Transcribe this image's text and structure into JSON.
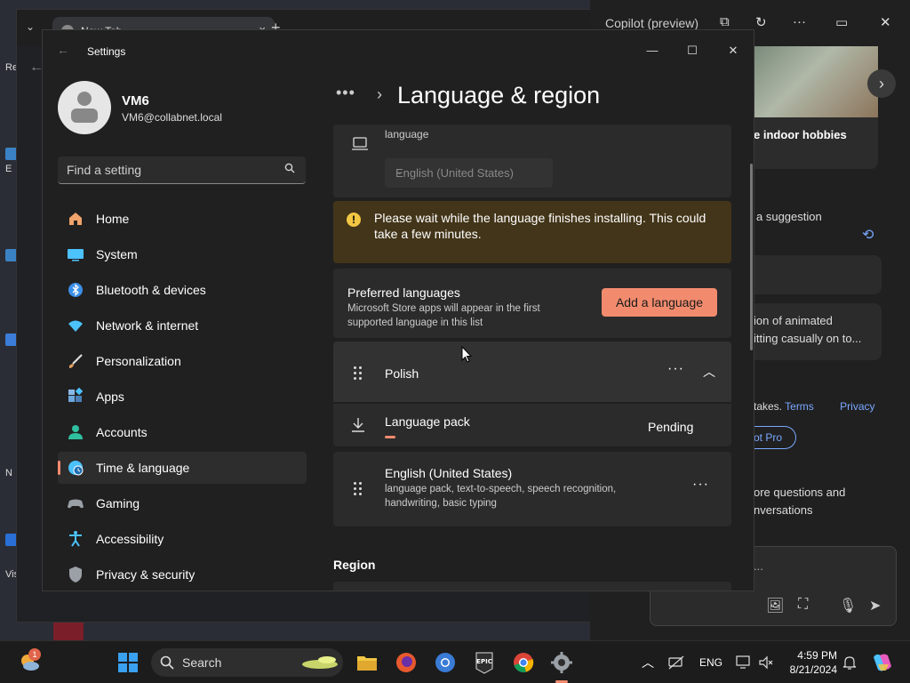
{
  "browser": {
    "tab_title": "New Tab",
    "new_tab_symbol": "+",
    "tab_close": "×"
  },
  "copilot": {
    "title": "Copilot (preview)",
    "card_text": "e indoor hobbies",
    "suggestion_header": "a suggestion",
    "suggestion_line1": "ion of animated",
    "suggestion_line2": "itting casually on to...",
    "terms_prefix": "takes.",
    "terms_link": "Terms",
    "privacy_link": "Privacy",
    "pro_label": "ot Pro",
    "more_line1": "ore questions and",
    "more_line2": "nversations",
    "input_placeholder": "..."
  },
  "desktop": {
    "labels": [
      "Re",
      "E",
      "N",
      "Vis"
    ]
  },
  "settings": {
    "window_title": "Settings",
    "user": {
      "name": "VM6",
      "email": "VM6@collabnet.local"
    },
    "search": {
      "placeholder": "Find a setting"
    },
    "nav": [
      {
        "label": "Home",
        "icon": "home-icon",
        "color": "#f0a36b"
      },
      {
        "label": "System",
        "icon": "system-icon",
        "color": "#4cc2ff"
      },
      {
        "label": "Bluetooth & devices",
        "icon": "bluetooth-icon",
        "color": "#3a8ee6"
      },
      {
        "label": "Network & internet",
        "icon": "wifi-icon",
        "color": "#4cc2ff"
      },
      {
        "label": "Personalization",
        "icon": "brush-icon",
        "color": "#e0a060"
      },
      {
        "label": "Apps",
        "icon": "apps-icon",
        "color": "#6fa8dc"
      },
      {
        "label": "Accounts",
        "icon": "person-icon",
        "color": "#2fbf9f"
      },
      {
        "label": "Time & language",
        "icon": "globe-clock-icon",
        "color": "#4cc2ff",
        "active": true
      },
      {
        "label": "Gaming",
        "icon": "gamepad-icon",
        "color": "#9aa0a6"
      },
      {
        "label": "Accessibility",
        "icon": "accessibility-icon",
        "color": "#4cc2ff"
      },
      {
        "label": "Privacy & security",
        "icon": "shield-icon",
        "color": "#9aa0a6"
      }
    ],
    "breadcrumb": {
      "more": "•••",
      "separator": "›",
      "title": "Language & region"
    },
    "display_language": {
      "label": "language",
      "selected": "English (United States)"
    },
    "warning": {
      "text": "Please wait while the language finishes installing. This could take a few minutes."
    },
    "preferred": {
      "title": "Preferred languages",
      "subtitle": "Microsoft Store apps will appear in the first supported language in this list",
      "add_button": "Add a language"
    },
    "languages": [
      {
        "name": "Polish",
        "expanded": true
      },
      {
        "name": "English (United States)",
        "features": "language pack, text-to-speech, speech recognition, handwriting, basic typing"
      }
    ],
    "language_pack": {
      "label": "Language pack",
      "status": "Pending",
      "progress": 0.03
    },
    "region_header": "Region"
  },
  "taskbar": {
    "search_label": "Search",
    "notification_count": "1",
    "language_indicator": "ENG",
    "time": "4:59 PM",
    "date": "8/21/2024",
    "pinned": [
      "file-explorer-icon",
      "firefox-icon",
      "chromium-icon",
      "epic-games-icon",
      "chrome-icon",
      "settings-icon"
    ]
  }
}
